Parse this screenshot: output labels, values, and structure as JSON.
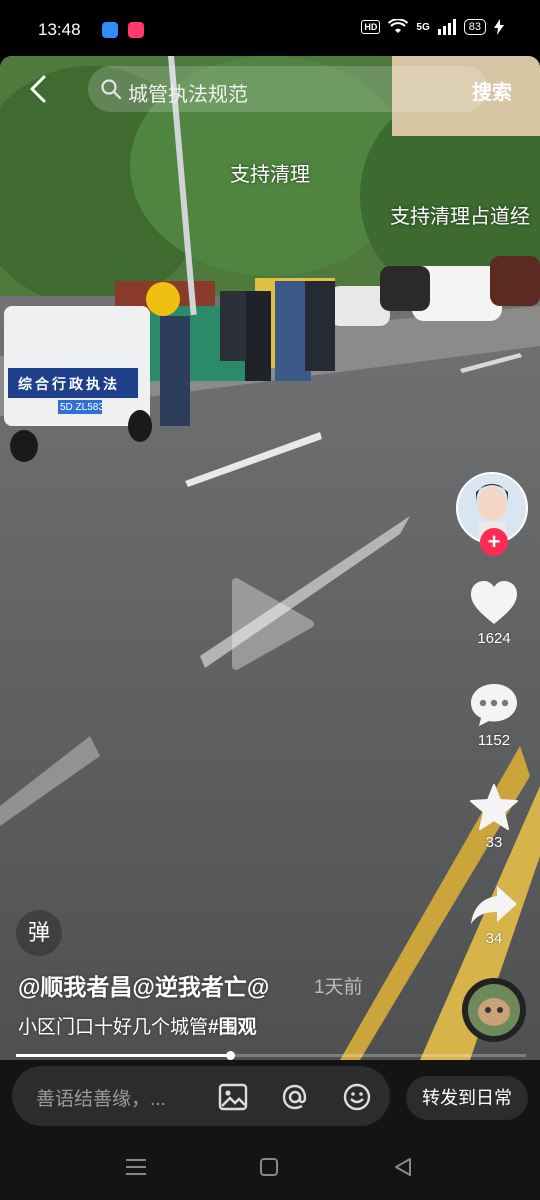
{
  "status_bar": {
    "time": "13:48",
    "network": "5G",
    "battery": "83",
    "hd_label": "HD"
  },
  "top_bar": {
    "search_query": "城管执法规范",
    "search_button": "搜索"
  },
  "video": {
    "danmaku": [
      "支持清理",
      "支持清理占道经"
    ],
    "vehicle_door_text": "综合行政执法",
    "plate_text": "5D ZL583"
  },
  "side_actions": {
    "like_count": "1624",
    "comment_count": "1152",
    "favorite_count": "33",
    "share_count": "34"
  },
  "post": {
    "danmu_toggle": "弹",
    "author": "@顺我者昌@逆我者亡@",
    "time_ago": "1天前",
    "caption_text": "小区门口十好几个城管",
    "caption_tag": "#围观",
    "progress": 0.42
  },
  "bottom_bar": {
    "comment_placeholder": "善语结善缘，...",
    "share_daily": "转发到日常"
  },
  "colors": {
    "accent": "#fe2c55",
    "background": "#000000",
    "bottom_bar": "#141414"
  }
}
